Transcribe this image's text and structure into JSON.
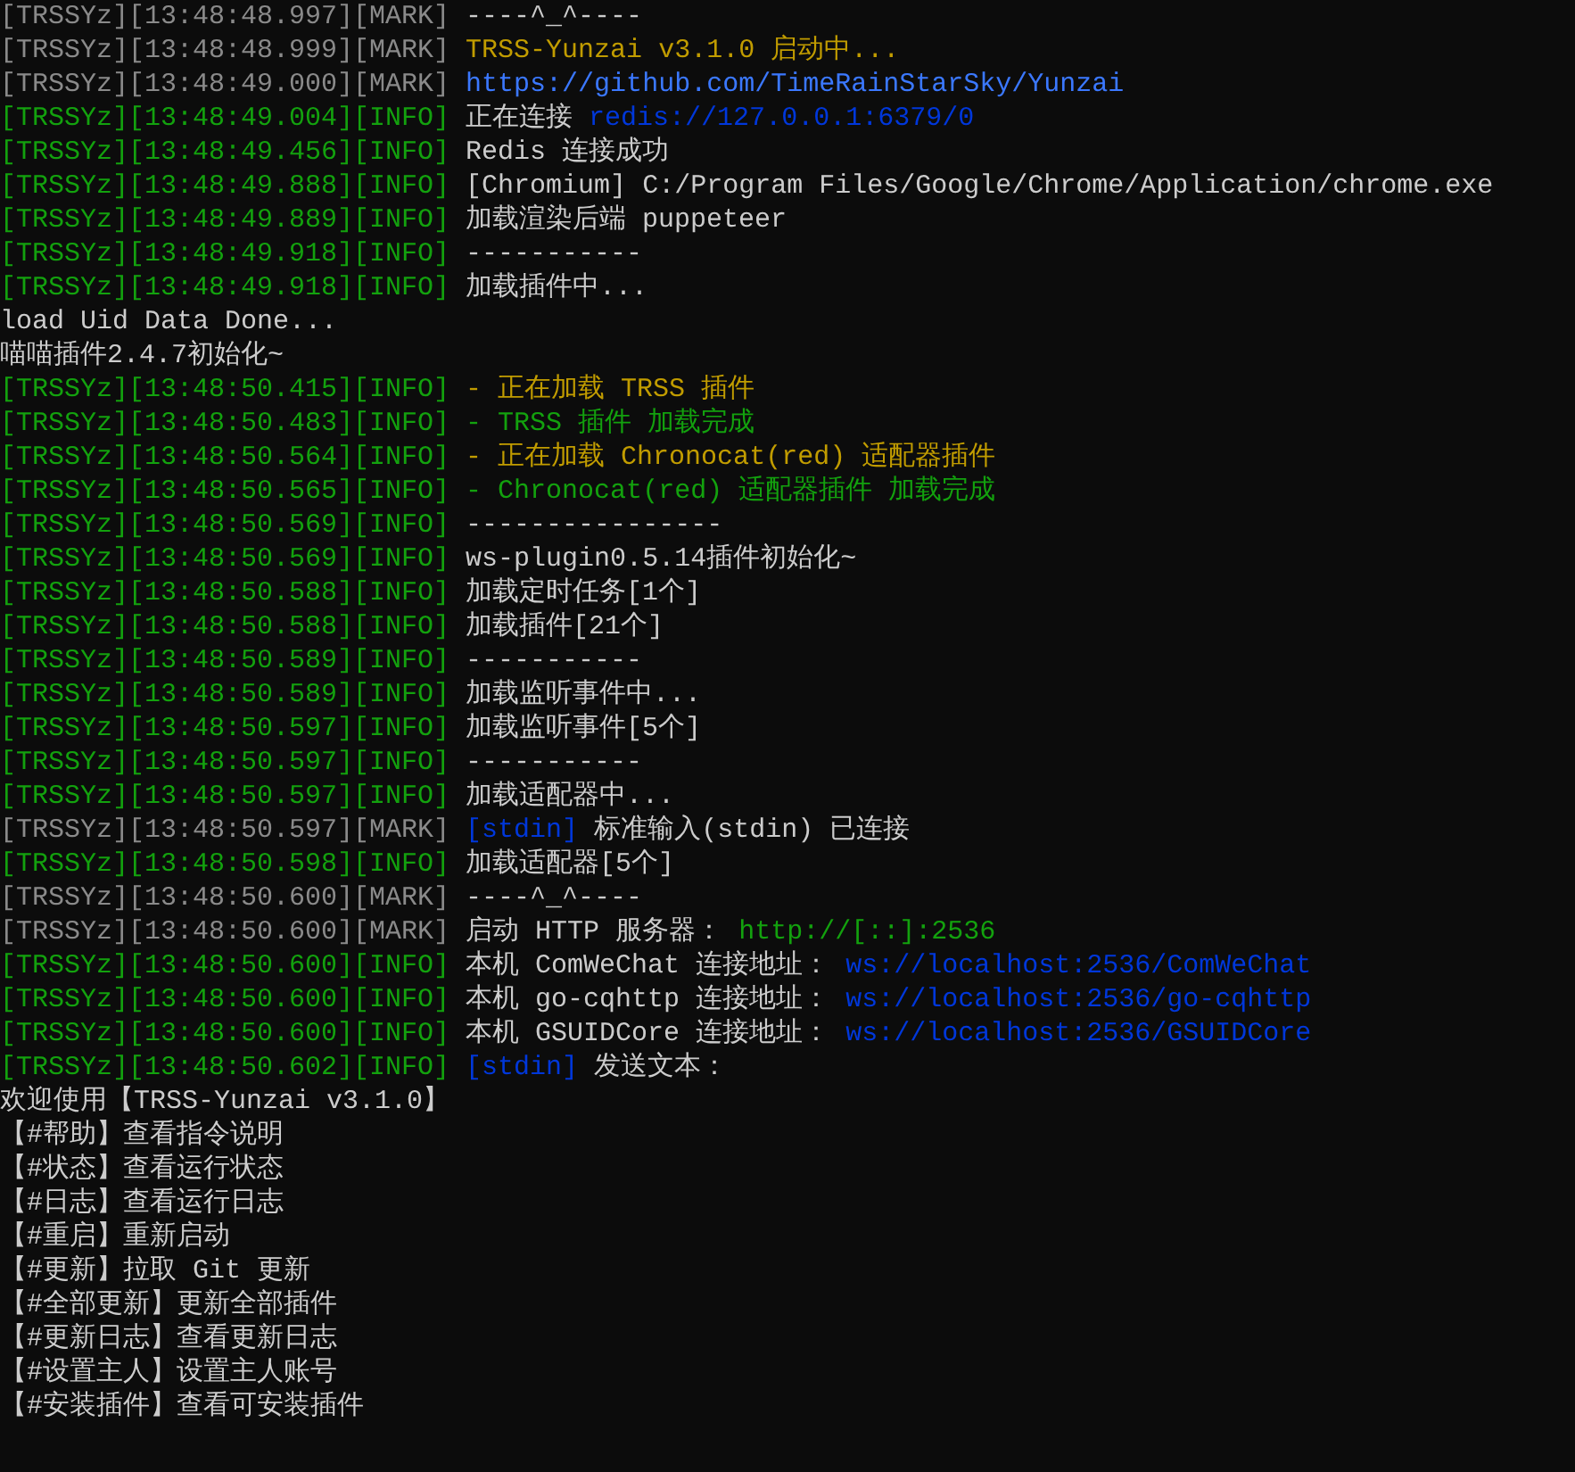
{
  "lines": [
    {
      "kind": "mark",
      "prefix": "[TRSSYz][13:48:48.997][MARK]",
      "segments": [
        {
          "text": "----^_^----",
          "color": "#cccccc"
        }
      ]
    },
    {
      "kind": "mark",
      "prefix": "[TRSSYz][13:48:48.999][MARK]",
      "segments": [
        {
          "text": "TRSS-Yunzai v3.1.0 启动中...",
          "color": "#c19c00"
        }
      ]
    },
    {
      "kind": "mark",
      "prefix": "[TRSSYz][13:48:49.000][MARK]",
      "segments": [
        {
          "text": "https://github.com/TimeRainStarSky/Yunzai",
          "color": "#3b78ff"
        }
      ]
    },
    {
      "kind": "info",
      "prefix": "[TRSSYz][13:48:49.004][INFO]",
      "segments": [
        {
          "text": "正在连接",
          "color": "#cccccc"
        },
        {
          "text": "redis://127.0.0.1:6379/0",
          "color": "#0037da"
        }
      ]
    },
    {
      "kind": "info",
      "prefix": "[TRSSYz][13:48:49.456][INFO]",
      "segments": [
        {
          "text": "Redis 连接成功",
          "color": "#cccccc"
        }
      ]
    },
    {
      "kind": "info",
      "prefix": "[TRSSYz][13:48:49.888][INFO]",
      "segments": [
        {
          "text": "[Chromium] C:/Program Files/Google/Chrome/Application/chrome.exe",
          "color": "#cccccc"
        }
      ]
    },
    {
      "kind": "info",
      "prefix": "[TRSSYz][13:48:49.889][INFO]",
      "segments": [
        {
          "text": "加载渲染后端 puppeteer",
          "color": "#cccccc"
        }
      ]
    },
    {
      "kind": "info",
      "prefix": "[TRSSYz][13:48:49.918][INFO]",
      "segments": [
        {
          "text": "-----------",
          "color": "#cccccc"
        }
      ]
    },
    {
      "kind": "info",
      "prefix": "[TRSSYz][13:48:49.918][INFO]",
      "segments": [
        {
          "text": "加载插件中...",
          "color": "#cccccc"
        }
      ]
    },
    {
      "kind": "plain",
      "segments": [
        {
          "text": "load Uid Data Done...",
          "color": "#cccccc"
        }
      ]
    },
    {
      "kind": "plain",
      "segments": [
        {
          "text": "喵喵插件2.4.7初始化~",
          "color": "#cccccc"
        }
      ]
    },
    {
      "kind": "info",
      "prefix": "[TRSSYz][13:48:50.415][INFO]",
      "segments": [
        {
          "text": "- 正在加载 TRSS 插件",
          "color": "#c19c00"
        }
      ]
    },
    {
      "kind": "info",
      "prefix": "[TRSSYz][13:48:50.483][INFO]",
      "segments": [
        {
          "text": "- TRSS 插件 加载完成",
          "color": "#13a10e"
        }
      ]
    },
    {
      "kind": "info",
      "prefix": "[TRSSYz][13:48:50.564][INFO]",
      "segments": [
        {
          "text": "- 正在加载 Chronocat(red) 适配器插件",
          "color": "#c19c00"
        }
      ]
    },
    {
      "kind": "info",
      "prefix": "[TRSSYz][13:48:50.565][INFO]",
      "segments": [
        {
          "text": "- Chronocat(red) 适配器插件 加载完成",
          "color": "#13a10e"
        }
      ]
    },
    {
      "kind": "info",
      "prefix": "[TRSSYz][13:48:50.569][INFO]",
      "segments": [
        {
          "text": "----------------",
          "color": "#cccccc"
        }
      ]
    },
    {
      "kind": "info",
      "prefix": "[TRSSYz][13:48:50.569][INFO]",
      "segments": [
        {
          "text": "ws-plugin0.5.14插件初始化~",
          "color": "#cccccc"
        }
      ]
    },
    {
      "kind": "info",
      "prefix": "[TRSSYz][13:48:50.588][INFO]",
      "segments": [
        {
          "text": "加载定时任务[1个]",
          "color": "#cccccc"
        }
      ]
    },
    {
      "kind": "info",
      "prefix": "[TRSSYz][13:48:50.588][INFO]",
      "segments": [
        {
          "text": "加载插件[21个]",
          "color": "#cccccc"
        }
      ]
    },
    {
      "kind": "info",
      "prefix": "[TRSSYz][13:48:50.589][INFO]",
      "segments": [
        {
          "text": "-----------",
          "color": "#cccccc"
        }
      ]
    },
    {
      "kind": "info",
      "prefix": "[TRSSYz][13:48:50.589][INFO]",
      "segments": [
        {
          "text": "加载监听事件中...",
          "color": "#cccccc"
        }
      ]
    },
    {
      "kind": "info",
      "prefix": "[TRSSYz][13:48:50.597][INFO]",
      "segments": [
        {
          "text": "加载监听事件[5个]",
          "color": "#cccccc"
        }
      ]
    },
    {
      "kind": "info",
      "prefix": "[TRSSYz][13:48:50.597][INFO]",
      "segments": [
        {
          "text": "-----------",
          "color": "#cccccc"
        }
      ]
    },
    {
      "kind": "info",
      "prefix": "[TRSSYz][13:48:50.597][INFO]",
      "segments": [
        {
          "text": "加载适配器中...",
          "color": "#cccccc"
        }
      ]
    },
    {
      "kind": "mark",
      "prefix": "[TRSSYz][13:48:50.597][MARK]",
      "segments": [
        {
          "text": "[stdin]",
          "color": "#0037da"
        },
        {
          "text": "标准输入(stdin) 已连接",
          "color": "#cccccc"
        }
      ]
    },
    {
      "kind": "info",
      "prefix": "[TRSSYz][13:48:50.598][INFO]",
      "segments": [
        {
          "text": "加载适配器[5个]",
          "color": "#cccccc"
        }
      ]
    },
    {
      "kind": "mark",
      "prefix": "[TRSSYz][13:48:50.600][MARK]",
      "segments": [
        {
          "text": "----^_^----",
          "color": "#cccccc"
        }
      ]
    },
    {
      "kind": "mark",
      "prefix": "[TRSSYz][13:48:50.600][MARK]",
      "segments": [
        {
          "text": "启动 HTTP 服务器：",
          "color": "#cccccc"
        },
        {
          "text": "http://[::]:2536",
          "color": "#13a10e"
        }
      ]
    },
    {
      "kind": "info",
      "prefix": "[TRSSYz][13:48:50.600][INFO]",
      "segments": [
        {
          "text": "本机 ComWeChat 连接地址：",
          "color": "#cccccc"
        },
        {
          "text": "ws://localhost:2536/ComWeChat",
          "color": "#0037da"
        }
      ]
    },
    {
      "kind": "info",
      "prefix": "[TRSSYz][13:48:50.600][INFO]",
      "segments": [
        {
          "text": "本机 go-cqhttp 连接地址：",
          "color": "#cccccc"
        },
        {
          "text": "ws://localhost:2536/go-cqhttp",
          "color": "#0037da"
        }
      ]
    },
    {
      "kind": "info",
      "prefix": "[TRSSYz][13:48:50.600][INFO]",
      "segments": [
        {
          "text": "本机 GSUIDCore 连接地址：",
          "color": "#cccccc"
        },
        {
          "text": "ws://localhost:2536/GSUIDCore",
          "color": "#0037da"
        }
      ]
    },
    {
      "kind": "info",
      "prefix": "[TRSSYz][13:48:50.602][INFO]",
      "segments": [
        {
          "text": "[stdin]",
          "color": "#0037da"
        },
        {
          "text": "发送文本：",
          "color": "#cccccc"
        }
      ]
    },
    {
      "kind": "plain",
      "segments": [
        {
          "text": "欢迎使用【TRSS-Yunzai v3.1.0】",
          "color": "#cccccc"
        }
      ]
    },
    {
      "kind": "plain",
      "segments": [
        {
          "text": "【#帮助】查看指令说明",
          "color": "#cccccc"
        }
      ]
    },
    {
      "kind": "plain",
      "segments": [
        {
          "text": "【#状态】查看运行状态",
          "color": "#cccccc"
        }
      ]
    },
    {
      "kind": "plain",
      "segments": [
        {
          "text": "【#日志】查看运行日志",
          "color": "#cccccc"
        }
      ]
    },
    {
      "kind": "plain",
      "segments": [
        {
          "text": "【#重启】重新启动",
          "color": "#cccccc"
        }
      ]
    },
    {
      "kind": "plain",
      "segments": [
        {
          "text": "【#更新】拉取 Git 更新",
          "color": "#cccccc"
        }
      ]
    },
    {
      "kind": "plain",
      "segments": [
        {
          "text": "【#全部更新】更新全部插件",
          "color": "#cccccc"
        }
      ]
    },
    {
      "kind": "plain",
      "segments": [
        {
          "text": "【#更新日志】查看更新日志",
          "color": "#cccccc"
        }
      ]
    },
    {
      "kind": "plain",
      "segments": [
        {
          "text": "【#设置主人】设置主人账号",
          "color": "#cccccc"
        }
      ]
    },
    {
      "kind": "plain",
      "segments": [
        {
          "text": "【#安装插件】查看可安装插件",
          "color": "#cccccc"
        }
      ]
    }
  ]
}
